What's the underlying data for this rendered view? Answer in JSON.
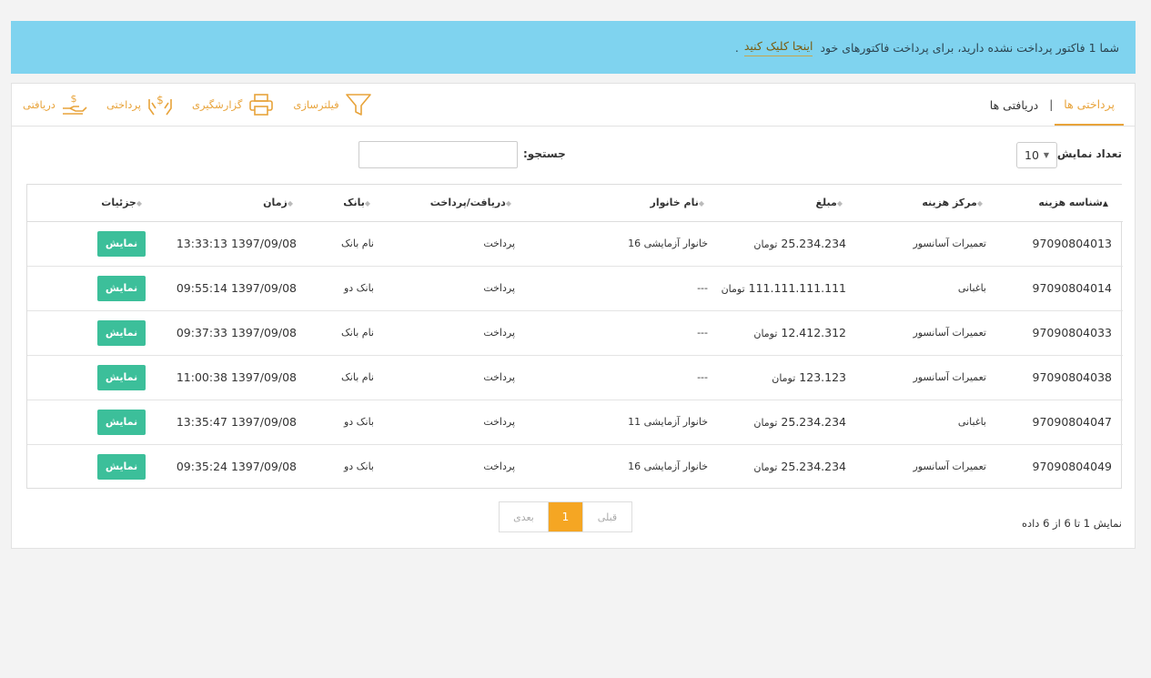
{
  "alert": {
    "message": "شما 1 فاکتور پرداخت نشده دارید، برای پرداخت فاکتورهای خود",
    "link": "اینجا کلیک کنید",
    "suffix": "."
  },
  "tabs": {
    "payments": "پرداختی ها",
    "separator": "|",
    "receipts": "دریافتی ها"
  },
  "tools": {
    "filter": "فیلترسازی",
    "report": "گزارشگیری",
    "payment": "پرداختی",
    "receipt": "دریافتی"
  },
  "controls": {
    "length_label": "تعداد نمایش",
    "length_value": "10",
    "search_label": "جستجو:",
    "search_value": ""
  },
  "table": {
    "headers": [
      "شناسه هزینه",
      "مرکز هزینه",
      "مبلغ",
      "نام خانوار",
      "دریافت/پرداخت",
      "بانک",
      "زمان",
      "جزئیات"
    ],
    "button_label": "نمایش",
    "rows": [
      {
        "id": "97090804013",
        "center": "تعمیرات آسانسور",
        "amount": "25.234.234",
        "unit": "تومان",
        "family": "خانوار آزمایشی 16",
        "type": "پرداخت",
        "bank": "نام بانک",
        "time": "1397/09/08 13:33:13"
      },
      {
        "id": "97090804014",
        "center": "باغبانی",
        "amount": "111.111.111.111",
        "unit": "تومان",
        "family": "---",
        "type": "پرداخت",
        "bank": "بانک دو",
        "time": "1397/09/08 09:55:14"
      },
      {
        "id": "97090804033",
        "center": "تعمیرات آسانسور",
        "amount": "12.412.312",
        "unit": "تومان",
        "family": "---",
        "type": "پرداخت",
        "bank": "نام بانک",
        "time": "1397/09/08 09:37:33"
      },
      {
        "id": "97090804038",
        "center": "تعمیرات آسانسور",
        "amount": "123.123",
        "unit": "تومان",
        "family": "---",
        "type": "پرداخت",
        "bank": "نام بانک",
        "time": "1397/09/08 11:00:38"
      },
      {
        "id": "97090804047",
        "center": "باغبانی",
        "amount": "25.234.234",
        "unit": "تومان",
        "family": "خانوار آزمایشی 11",
        "type": "پرداخت",
        "bank": "بانک دو",
        "time": "1397/09/08 13:35:47"
      },
      {
        "id": "97090804049",
        "center": "تعمیرات آسانسور",
        "amount": "25.234.234",
        "unit": "تومان",
        "family": "خانوار آزمایشی 16",
        "type": "پرداخت",
        "bank": "بانک دو",
        "time": "1397/09/08 09:35:24"
      }
    ]
  },
  "footer": {
    "info": "نمایش 1 تا 6 از 6 داده",
    "prev": "قبلی",
    "current": "1",
    "next": "بعدی"
  },
  "colors": {
    "accent": "#e8a33a",
    "alert_bg": "#7fd3ef",
    "button": "#3cbf9a",
    "page_current": "#f5a623"
  }
}
